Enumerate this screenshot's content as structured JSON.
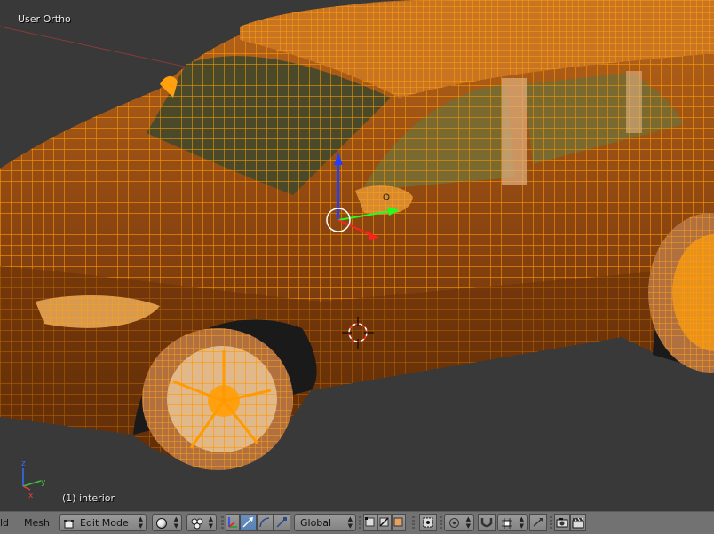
{
  "viewport": {
    "view_label": "User Ortho",
    "object_label": "(1) interior",
    "mini_axis": {
      "z": "z",
      "y": "y",
      "x": "x"
    },
    "colors": {
      "background": "#393939",
      "wire": "#ff9a00",
      "face": "#8a4a10",
      "glass": "#4a4a2a"
    }
  },
  "header": {
    "menu_cut": "ld",
    "menu_mesh": "Mesh",
    "mode_icon": "edit-mode-icon",
    "mode_label": "Edit Mode",
    "shading_icon": "solid-sphere-icon",
    "pivot_icon": "pivot-dots-icon",
    "transform_orientation": "Global",
    "colors": {
      "bar": "#727272",
      "active": "#5680b4"
    }
  }
}
